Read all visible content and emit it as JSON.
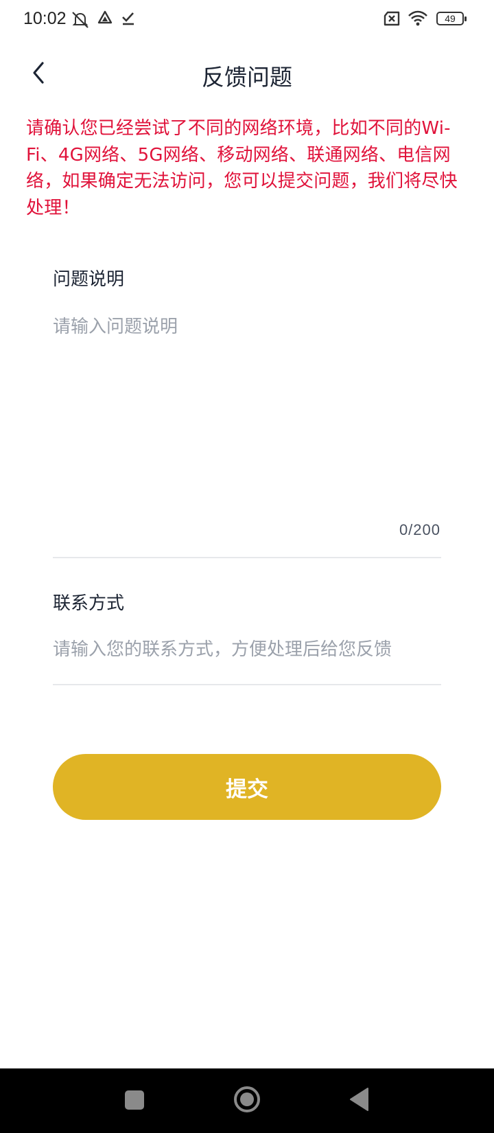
{
  "status_bar": {
    "time": "10:02",
    "battery": "49",
    "icons": [
      "notifications-muted-icon",
      "drive-icon",
      "download-done-icon",
      "no-sim-icon",
      "wifi-icon",
      "battery-icon"
    ]
  },
  "header": {
    "title": "反馈问题",
    "back_icon": "chevron-left-icon"
  },
  "warning": {
    "text": "请确认您已经尝试了不同的网络环境，比如不同的Wi-Fi、4G网络、5G网络、移动网络、联通网络、电信网络，如果确定无法访问，您可以提交问题，我们将尽快处理！",
    "color": "#e0123a"
  },
  "form": {
    "description": {
      "label": "问题说明",
      "placeholder": "请输入问题说明",
      "value": "",
      "counter": "0/200"
    },
    "contact": {
      "label": "联系方式",
      "placeholder": "请输入您的联系方式，方便处理后给您反馈",
      "value": ""
    },
    "submit_label": "提交",
    "accent_color": "#e0b425"
  },
  "nav_bar": {
    "icons": [
      "recent-apps-icon",
      "home-icon",
      "back-triangle-icon"
    ]
  }
}
